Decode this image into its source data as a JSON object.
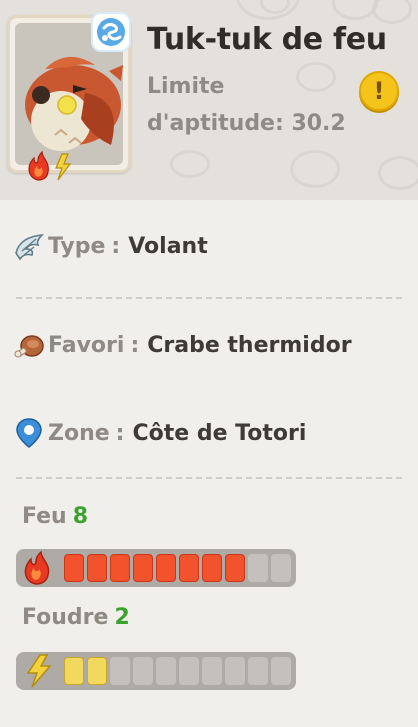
{
  "creature": {
    "name": "Tuk-tuk de feu",
    "limit_label": "Limite d'aptitude: 30.2"
  },
  "info": {
    "type_key": "Type",
    "type_value": "Volant",
    "favorite_key": "Favori",
    "favorite_value": "Crabe thermidor",
    "zone_key": "Zone",
    "zone_value": "Côte de Totori",
    "separator": ":"
  },
  "stats": [
    {
      "name": "Feu",
      "value": "8",
      "max": 10,
      "fill_color": "#f2522c",
      "fill_border": "#c9381a"
    },
    {
      "name": "Foudre",
      "value": "2",
      "max": 10,
      "fill_color": "#f2d85c",
      "fill_border": "#caa82c"
    }
  ],
  "colors": {
    "stat_value_green": "#3aa32e",
    "info_button": "#f4c41c"
  },
  "icons": {
    "species_badge": "wind-swirl-icon",
    "element_fire": "fire-icon",
    "element_lightning": "lightning-icon",
    "type": "wing-icon",
    "favorite": "meat-icon",
    "zone": "location-pin-icon",
    "info": "exclamation-icon"
  }
}
